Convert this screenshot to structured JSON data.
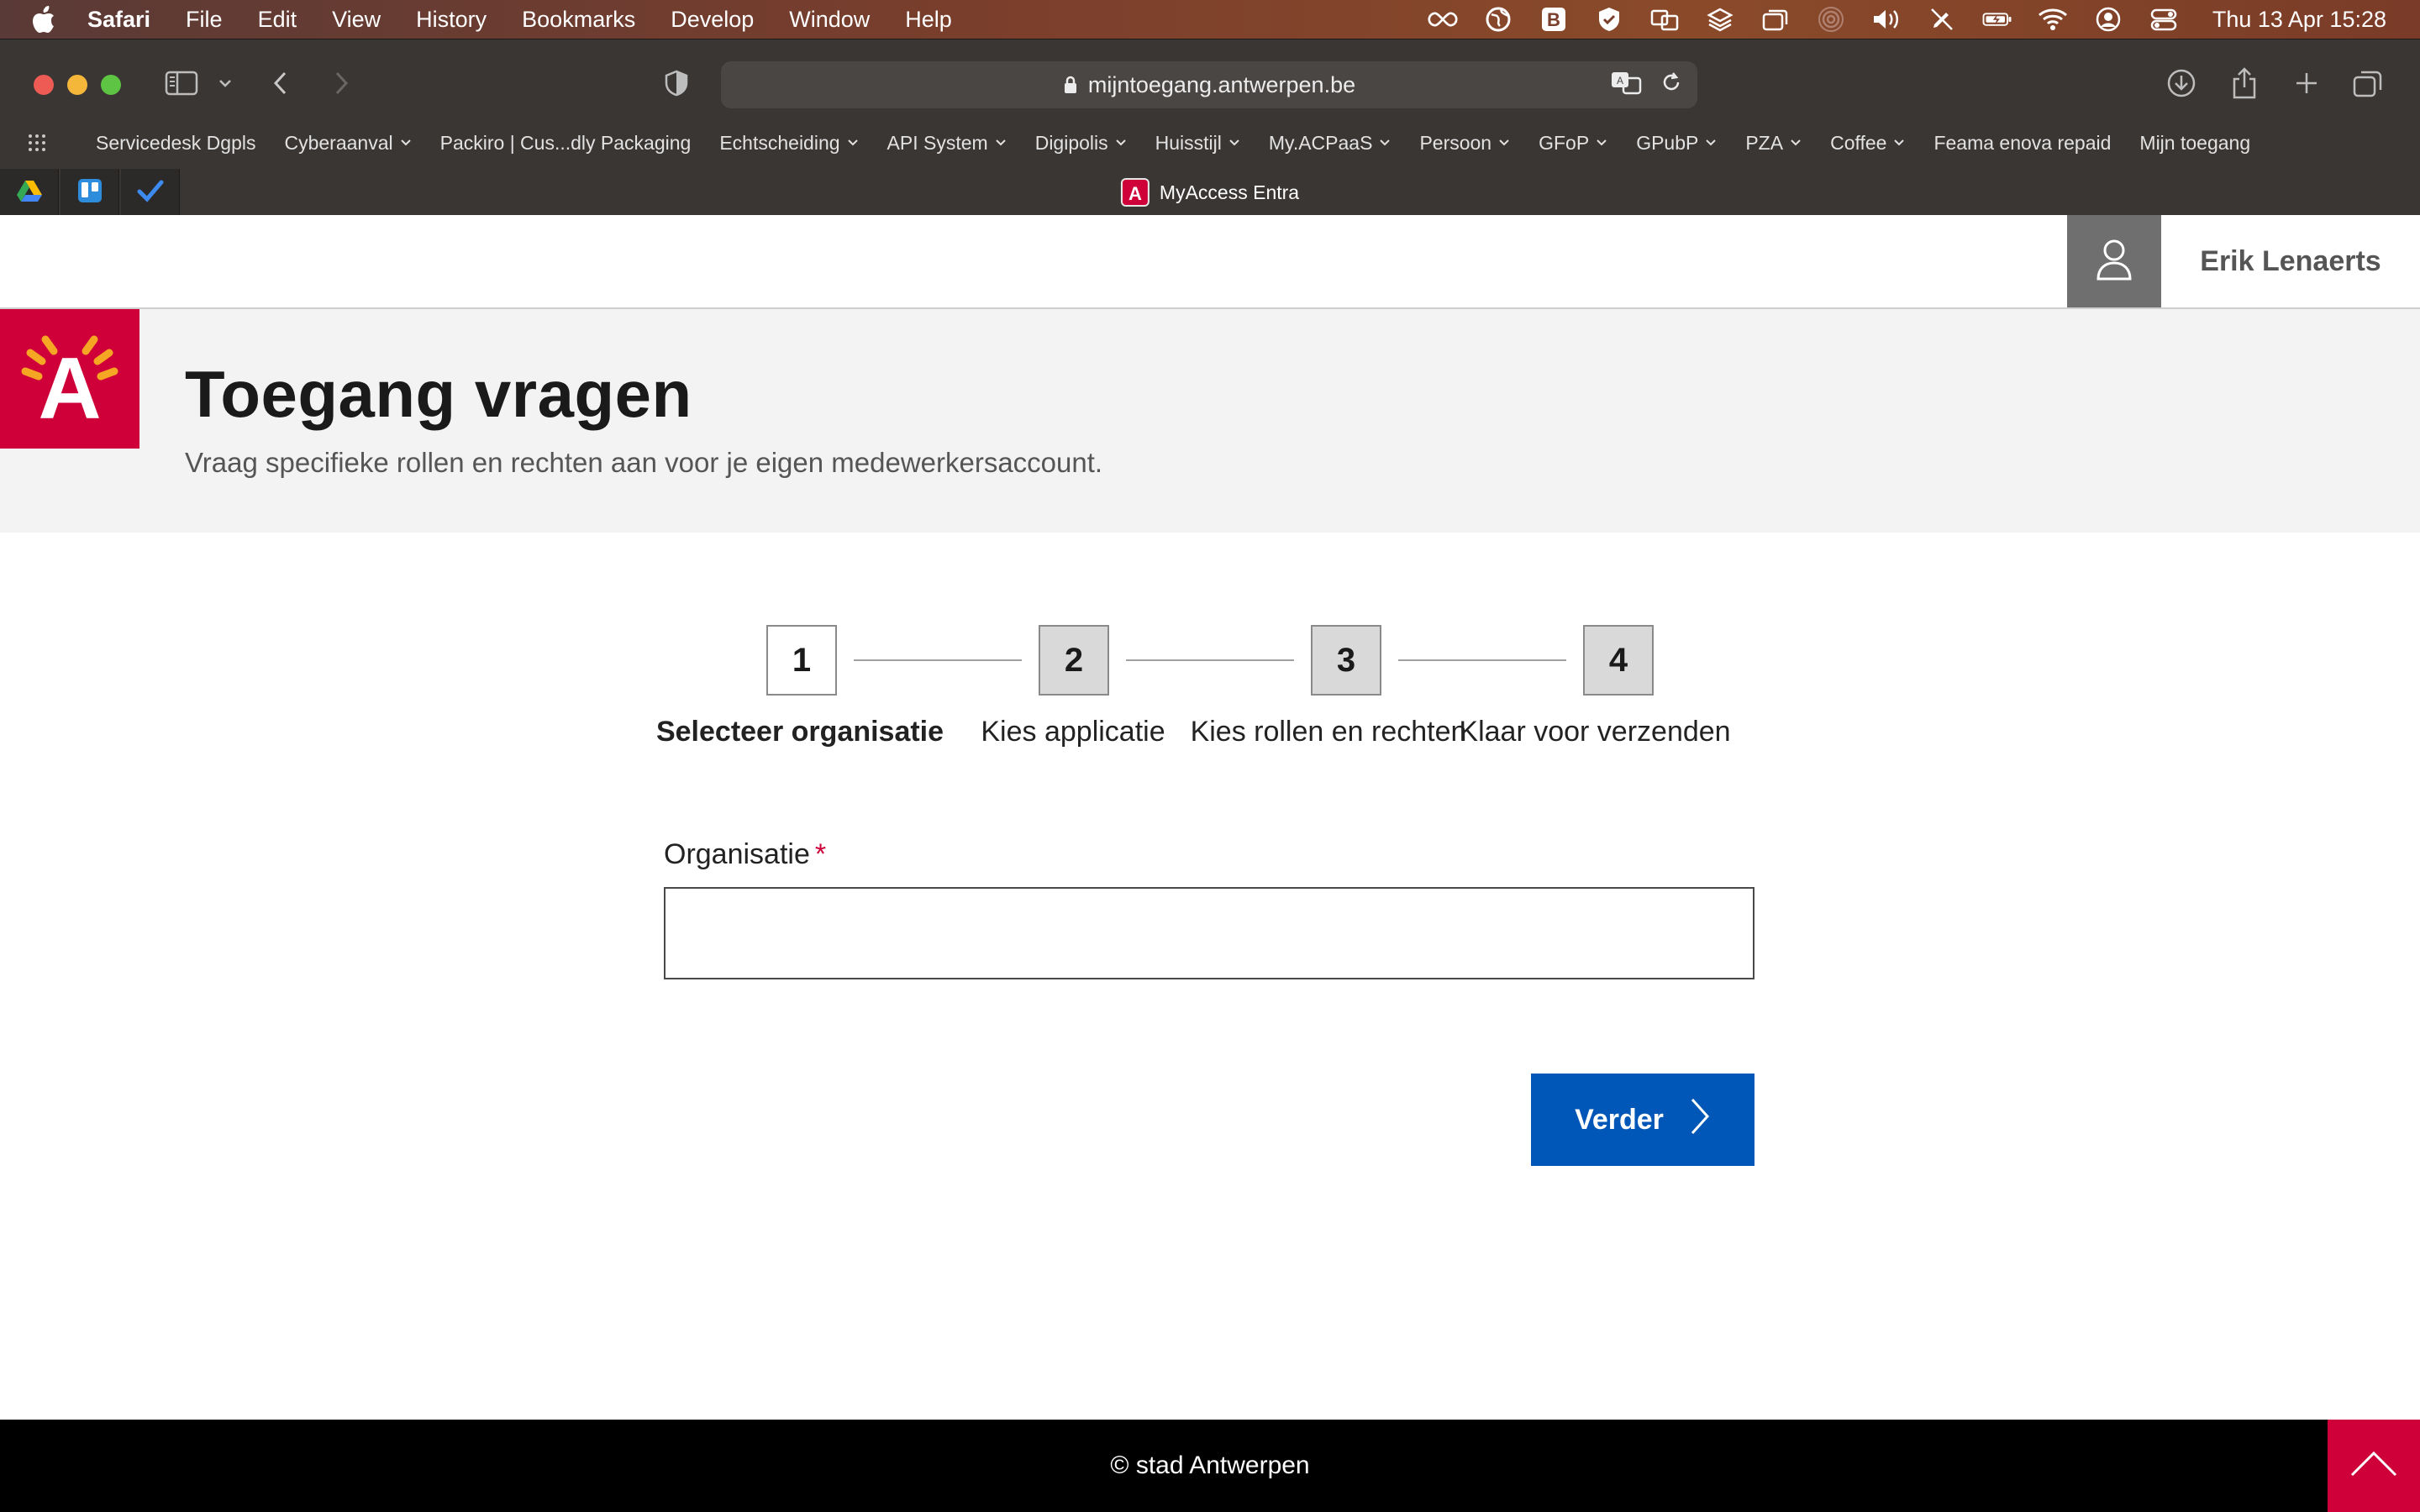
{
  "os_menubar": {
    "app_name": "Safari",
    "menus": [
      "File",
      "Edit",
      "View",
      "History",
      "Bookmarks",
      "Develop",
      "Window",
      "Help"
    ],
    "clock": "Thu 13 Apr  15:28"
  },
  "browser": {
    "url": "mijntoegang.antwerpen.be",
    "bookmarks": [
      {
        "label": "Servicedesk Dgpls",
        "folder": false
      },
      {
        "label": "Cyberaanval",
        "folder": true
      },
      {
        "label": "Packiro | Cus...dly Packaging",
        "folder": false
      },
      {
        "label": "Echtscheiding",
        "folder": true
      },
      {
        "label": "API System",
        "folder": true
      },
      {
        "label": "Digipolis",
        "folder": true
      },
      {
        "label": "Huisstijl",
        "folder": true
      },
      {
        "label": "My.ACPaaS",
        "folder": true
      },
      {
        "label": "Persoon",
        "folder": true
      },
      {
        "label": "GFoP",
        "folder": true
      },
      {
        "label": "GPubP",
        "folder": true
      },
      {
        "label": "PZA",
        "folder": true
      },
      {
        "label": "Coffee",
        "folder": true
      },
      {
        "label": "Feama enova repaid",
        "folder": false
      },
      {
        "label": "Mijn toegang",
        "folder": false
      }
    ],
    "active_tab_title": "MyAccess Entra"
  },
  "header": {
    "user_name": "Erik Lenaerts"
  },
  "hero": {
    "logo_letter": "A",
    "title": "Toegang vragen",
    "subtitle": "Vraag specifieke rollen en rechten aan voor je eigen medewerkersaccount."
  },
  "steps": [
    {
      "number": "1",
      "label": "Selecteer organisatie",
      "active": true
    },
    {
      "number": "2",
      "label": "Kies applicatie",
      "active": false
    },
    {
      "number": "3",
      "label": "Kies rollen en rechten",
      "active": false
    },
    {
      "number": "4",
      "label": "Klaar voor verzenden",
      "active": false
    }
  ],
  "form": {
    "organisation_label": "Organisatie",
    "required_marker": "*",
    "organisation_value": "",
    "next_button": "Verder"
  },
  "footer": {
    "copyright": "© stad Antwerpen"
  },
  "colors": {
    "brand_red": "#cf0039",
    "primary_blue": "#0057b7"
  }
}
